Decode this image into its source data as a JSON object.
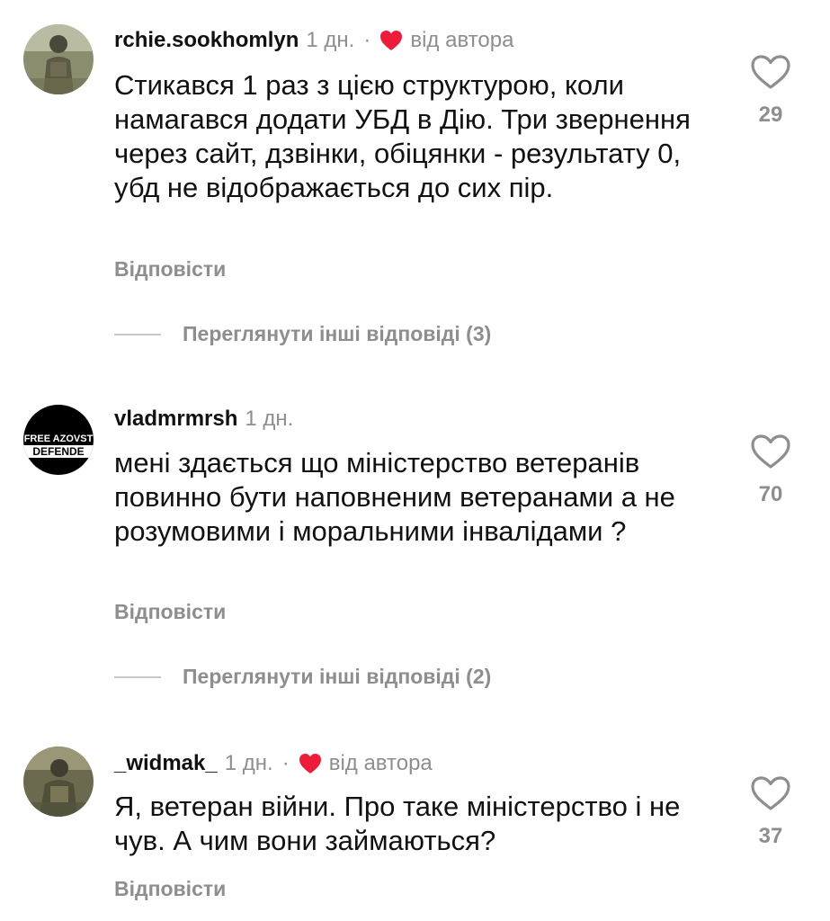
{
  "comments": [
    {
      "username": "rchie.sookhomlyn",
      "time": "1 дн.",
      "separator": "·",
      "author_liked": "від автора",
      "text": "Стикався 1 раз з цією структурою, коли намагався додати УБД в Дію. Три звернення через сайт, дзвінки, обіцянки - результату 0, убд не відображається до сих пір.",
      "reply_label": "Відповісти",
      "likes": "29",
      "view_replies": "Переглянути інші відповіді (3)",
      "avatar_icon": "soldier-photo-avatar"
    },
    {
      "username": "vladmrmrsh",
      "time": "1 дн.",
      "avatar_text_top": "FREE AZOVST",
      "avatar_text_bottom": "DEFENDE",
      "text": "мені здається що міністерство ветеранів повинно бути наповненим ветеранами а не розумовими і моральними інвалідами ?",
      "reply_label": "Відповісти",
      "likes": "70",
      "view_replies": "Переглянути інші відповіді (2)",
      "avatar_icon": "free-azovstal-defenders-avatar"
    },
    {
      "username": "_widmak_",
      "time": "1 дн.",
      "separator": "·",
      "author_liked": "від автора",
      "text": "Я, ветеран війни. Про таке міністерство і не чув. А чим вони займаються?",
      "reply_label": "Відповісти",
      "likes": "37",
      "avatar_icon": "soldier-photo-avatar"
    }
  ],
  "colors": {
    "text": "#111111",
    "secondary": "#8e8e8e",
    "heart_red": "#ed1c3a",
    "divider": "#c7c7c7"
  }
}
